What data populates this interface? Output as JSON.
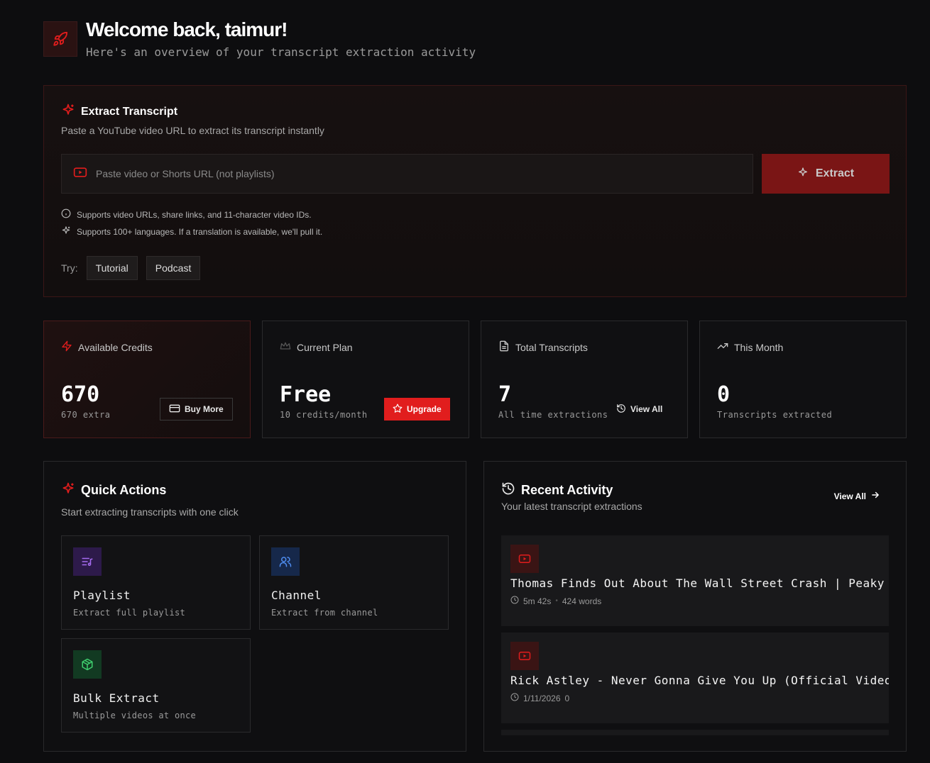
{
  "header": {
    "welcome": "Welcome back, taimur!",
    "subtitle": "Here's an overview of your transcript extraction activity"
  },
  "extract": {
    "title": "Extract Transcript",
    "description": "Paste a YouTube video URL to extract its transcript instantly",
    "input_placeholder": "Paste video or Shorts URL (not playlists)",
    "input_value": "",
    "button_label": "Extract",
    "hint_1": "Supports video URLs, share links, and 11-character video IDs.",
    "hint_2": "Supports 100+ languages. If a translation is available, we'll pull it.",
    "try_label": "Try:",
    "try_chips": [
      "Tutorial",
      "Podcast"
    ]
  },
  "stats": {
    "credits": {
      "label": "Available Credits",
      "value": "670",
      "sub": "670 extra",
      "button": "Buy More"
    },
    "plan": {
      "label": "Current Plan",
      "value": "Free",
      "sub": "10 credits/month",
      "button": "Upgrade"
    },
    "transcripts": {
      "label": "Total Transcripts",
      "value": "7",
      "sub": "All time extractions",
      "button": "View All"
    },
    "month": {
      "label": "This Month",
      "value": "0",
      "sub": "Transcripts extracted"
    }
  },
  "quick_actions": {
    "title": "Quick Actions",
    "description": "Start extracting transcripts with one click",
    "items": [
      {
        "name": "Playlist",
        "desc": "Extract full playlist"
      },
      {
        "name": "Channel",
        "desc": "Extract from channel"
      },
      {
        "name": "Bulk Extract",
        "desc": "Multiple videos at once"
      }
    ]
  },
  "recent": {
    "title": "Recent Activity",
    "description": "Your latest transcript extractions",
    "view_all": "View All",
    "items": [
      {
        "title": "Thomas Finds Out About The Wall Street Crash | Peaky Blinders",
        "meta_1": "5m 42s",
        "meta_2": "424 words"
      },
      {
        "title": "Rick Astley - Never Gonna Give You Up (Official Video)",
        "meta_1": "1/11/2026",
        "meta_2": "0"
      }
    ]
  },
  "colors": {
    "accent": "#e11d1d",
    "background": "#0d0d0f",
    "panel_border_red": "#3b1616"
  }
}
